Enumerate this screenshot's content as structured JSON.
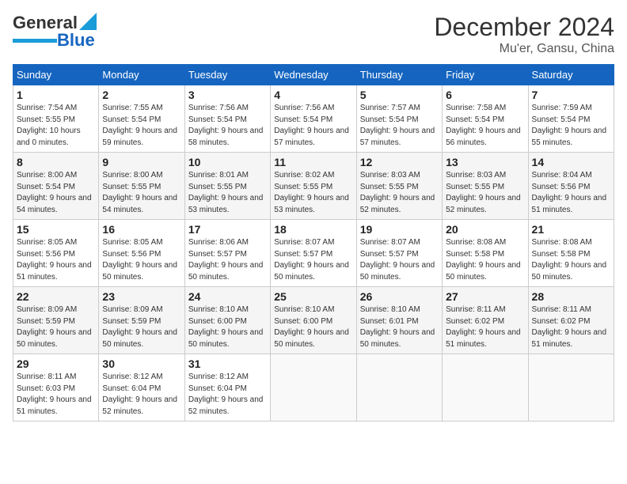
{
  "header": {
    "logo_line1": "General",
    "logo_line2": "Blue",
    "title": "December 2024",
    "subtitle": "Mu'er, Gansu, China"
  },
  "days_of_week": [
    "Sunday",
    "Monday",
    "Tuesday",
    "Wednesday",
    "Thursday",
    "Friday",
    "Saturday"
  ],
  "weeks": [
    [
      {
        "day": "1",
        "sunrise": "7:54 AM",
        "sunset": "5:55 PM",
        "daylight": "10 hours and 0 minutes."
      },
      {
        "day": "2",
        "sunrise": "7:55 AM",
        "sunset": "5:54 PM",
        "daylight": "9 hours and 59 minutes."
      },
      {
        "day": "3",
        "sunrise": "7:56 AM",
        "sunset": "5:54 PM",
        "daylight": "9 hours and 58 minutes."
      },
      {
        "day": "4",
        "sunrise": "7:56 AM",
        "sunset": "5:54 PM",
        "daylight": "9 hours and 57 minutes."
      },
      {
        "day": "5",
        "sunrise": "7:57 AM",
        "sunset": "5:54 PM",
        "daylight": "9 hours and 57 minutes."
      },
      {
        "day": "6",
        "sunrise": "7:58 AM",
        "sunset": "5:54 PM",
        "daylight": "9 hours and 56 minutes."
      },
      {
        "day": "7",
        "sunrise": "7:59 AM",
        "sunset": "5:54 PM",
        "daylight": "9 hours and 55 minutes."
      }
    ],
    [
      {
        "day": "8",
        "sunrise": "8:00 AM",
        "sunset": "5:54 PM",
        "daylight": "9 hours and 54 minutes."
      },
      {
        "day": "9",
        "sunrise": "8:00 AM",
        "sunset": "5:55 PM",
        "daylight": "9 hours and 54 minutes."
      },
      {
        "day": "10",
        "sunrise": "8:01 AM",
        "sunset": "5:55 PM",
        "daylight": "9 hours and 53 minutes."
      },
      {
        "day": "11",
        "sunrise": "8:02 AM",
        "sunset": "5:55 PM",
        "daylight": "9 hours and 53 minutes."
      },
      {
        "day": "12",
        "sunrise": "8:03 AM",
        "sunset": "5:55 PM",
        "daylight": "9 hours and 52 minutes."
      },
      {
        "day": "13",
        "sunrise": "8:03 AM",
        "sunset": "5:55 PM",
        "daylight": "9 hours and 52 minutes."
      },
      {
        "day": "14",
        "sunrise": "8:04 AM",
        "sunset": "5:56 PM",
        "daylight": "9 hours and 51 minutes."
      }
    ],
    [
      {
        "day": "15",
        "sunrise": "8:05 AM",
        "sunset": "5:56 PM",
        "daylight": "9 hours and 51 minutes."
      },
      {
        "day": "16",
        "sunrise": "8:05 AM",
        "sunset": "5:56 PM",
        "daylight": "9 hours and 50 minutes."
      },
      {
        "day": "17",
        "sunrise": "8:06 AM",
        "sunset": "5:57 PM",
        "daylight": "9 hours and 50 minutes."
      },
      {
        "day": "18",
        "sunrise": "8:07 AM",
        "sunset": "5:57 PM",
        "daylight": "9 hours and 50 minutes."
      },
      {
        "day": "19",
        "sunrise": "8:07 AM",
        "sunset": "5:57 PM",
        "daylight": "9 hours and 50 minutes."
      },
      {
        "day": "20",
        "sunrise": "8:08 AM",
        "sunset": "5:58 PM",
        "daylight": "9 hours and 50 minutes."
      },
      {
        "day": "21",
        "sunrise": "8:08 AM",
        "sunset": "5:58 PM",
        "daylight": "9 hours and 50 minutes."
      }
    ],
    [
      {
        "day": "22",
        "sunrise": "8:09 AM",
        "sunset": "5:59 PM",
        "daylight": "9 hours and 50 minutes."
      },
      {
        "day": "23",
        "sunrise": "8:09 AM",
        "sunset": "5:59 PM",
        "daylight": "9 hours and 50 minutes."
      },
      {
        "day": "24",
        "sunrise": "8:10 AM",
        "sunset": "6:00 PM",
        "daylight": "9 hours and 50 minutes."
      },
      {
        "day": "25",
        "sunrise": "8:10 AM",
        "sunset": "6:00 PM",
        "daylight": "9 hours and 50 minutes."
      },
      {
        "day": "26",
        "sunrise": "8:10 AM",
        "sunset": "6:01 PM",
        "daylight": "9 hours and 50 minutes."
      },
      {
        "day": "27",
        "sunrise": "8:11 AM",
        "sunset": "6:02 PM",
        "daylight": "9 hours and 51 minutes."
      },
      {
        "day": "28",
        "sunrise": "8:11 AM",
        "sunset": "6:02 PM",
        "daylight": "9 hours and 51 minutes."
      }
    ],
    [
      {
        "day": "29",
        "sunrise": "8:11 AM",
        "sunset": "6:03 PM",
        "daylight": "9 hours and 51 minutes."
      },
      {
        "day": "30",
        "sunrise": "8:12 AM",
        "sunset": "6:04 PM",
        "daylight": "9 hours and 52 minutes."
      },
      {
        "day": "31",
        "sunrise": "8:12 AM",
        "sunset": "6:04 PM",
        "daylight": "9 hours and 52 minutes."
      },
      null,
      null,
      null,
      null
    ]
  ]
}
